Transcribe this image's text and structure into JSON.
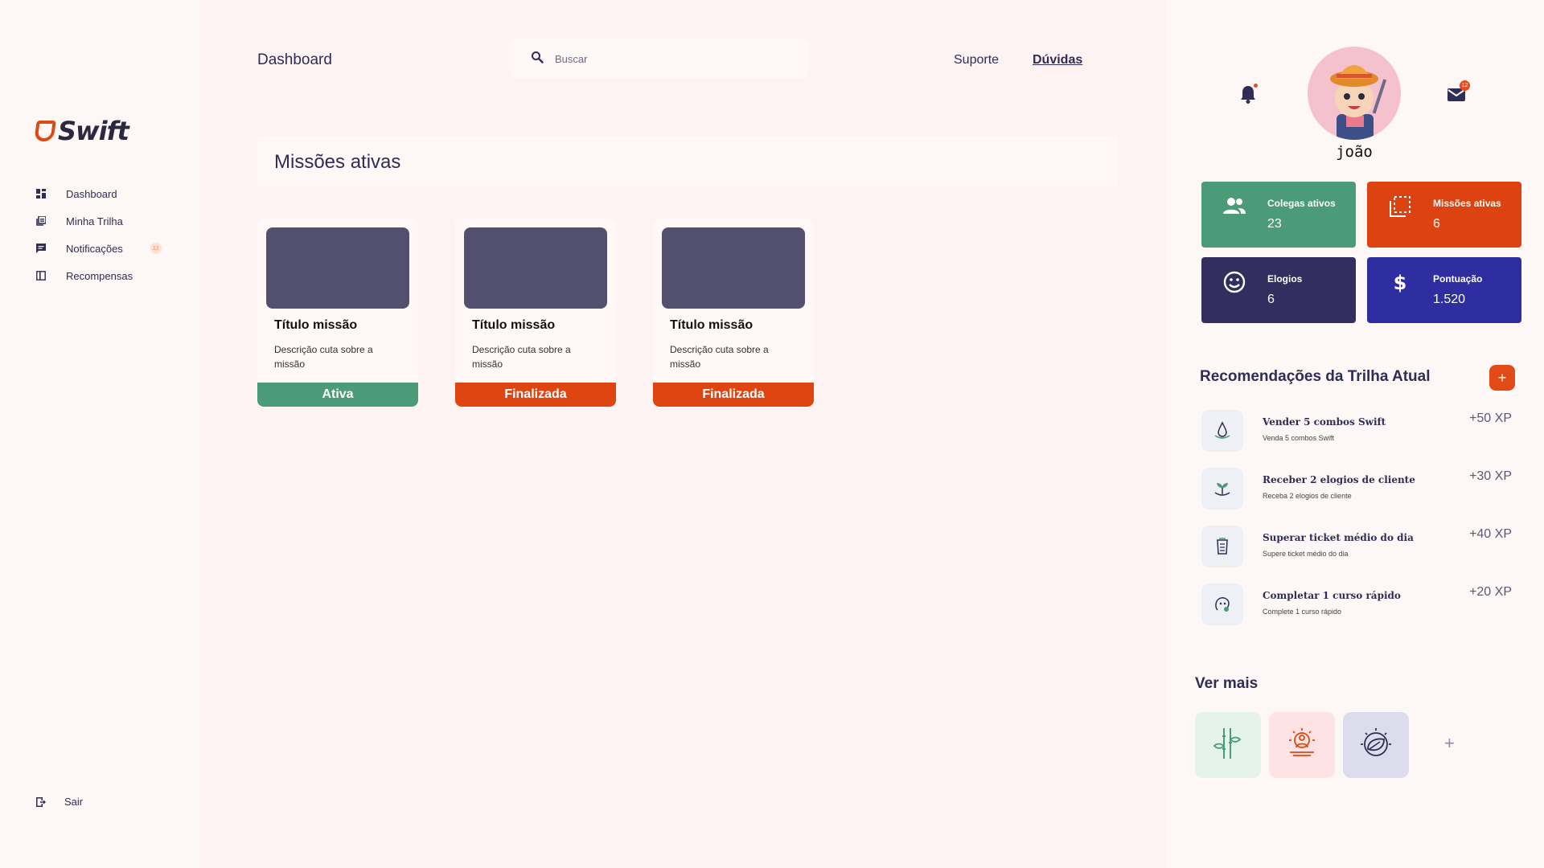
{
  "sidebar": {
    "brand": "Swift",
    "items": [
      {
        "label": "Dashboard",
        "icon": "dashboard-icon"
      },
      {
        "label": "Minha Trilha",
        "icon": "library-icon"
      },
      {
        "label": "Notificações",
        "icon": "message-icon",
        "badge": "12"
      },
      {
        "label": "Recompensas",
        "icon": "rewards-icon"
      }
    ],
    "logout_label": "Sair"
  },
  "header": {
    "title": "Dashboard",
    "search_placeholder": "Buscar",
    "links": {
      "support": "Suporte",
      "faq": "Dúvidas"
    }
  },
  "main": {
    "section_title": "Missões ativas",
    "missions": [
      {
        "title": "Título missão",
        "description": "Descrição cuta sobre a missão",
        "status": "Ativa",
        "status_color": "#4b9a78"
      },
      {
        "title": "Título missão",
        "description": "Descrição cuta sobre a missão",
        "status": "Finalizada",
        "status_color": "#de4511"
      },
      {
        "title": "Título missão",
        "description": "Descrição cuta sobre a missão",
        "status": "Finalizada",
        "status_color": "#de4511"
      }
    ]
  },
  "profile": {
    "username": "joão",
    "mail_badge": "12",
    "stats": [
      {
        "label": "Colegas ativos",
        "value": "23",
        "color": "#4b9a78",
        "icon": "people-icon"
      },
      {
        "label": "Missões ativas",
        "value": "6",
        "color": "#dc4310",
        "icon": "select-area-icon"
      },
      {
        "label": "Elogios",
        "value": "6",
        "color": "#322f60",
        "icon": "smile-icon"
      },
      {
        "label": "Pontuação",
        "value": "1.520",
        "color": "#2f2ea0",
        "icon": "dollar-icon"
      }
    ]
  },
  "recommendations": {
    "title": "Recomendações da Trilha Atual",
    "add_label": "+",
    "items": [
      {
        "name": "Vender 5 combos Swift",
        "subtitle": "Venda 5 combos Swift",
        "xp": "+50 XP",
        "icon": "drop-icon"
      },
      {
        "name": "Receber 2 elogios de cliente",
        "subtitle": "Receba 2 elogios de cliente",
        "xp": "+30 XP",
        "icon": "plant-icon"
      },
      {
        "name": "Superar ticket médio do dia",
        "subtitle": "Supere ticket médio do dia",
        "xp": "+40 XP",
        "icon": "building-icon"
      },
      {
        "name": "Completar 1 curso rápido",
        "subtitle": "Complete 1 curso rápido",
        "xp": "+20 XP",
        "icon": "brain-icon"
      }
    ]
  },
  "more": {
    "title": "Ver mais",
    "plus_label": "+",
    "tiles": [
      {
        "icon": "bamboo-icon",
        "bg": "#e4f3ec",
        "color": "#4b9a78"
      },
      {
        "icon": "meditation-icon",
        "bg": "#fde3e3",
        "color": "#dc4a12"
      },
      {
        "icon": "leaf-sun-icon",
        "bg": "#dcdcec",
        "color": "#2f2d56"
      }
    ]
  },
  "colors": {
    "accent": "#dc4a12",
    "navy": "#2f2d56",
    "background": "#fdf3f3"
  }
}
